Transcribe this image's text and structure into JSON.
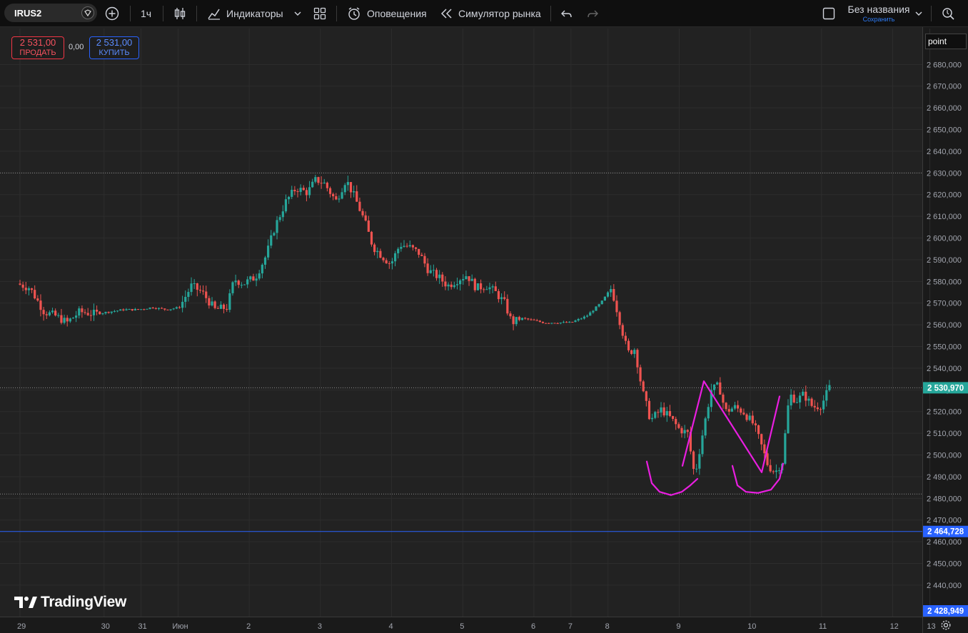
{
  "toolbar": {
    "symbol": "IRUS2",
    "interval": "1ч",
    "indicators_label": "Индикаторы",
    "alerts_label": "Оповещения",
    "replay_label": "Симулятор рынка",
    "layout_title": "Без названия",
    "save_label": "Сохранить"
  },
  "trade": {
    "sell_price": "2 531,00",
    "sell_label": "ПРОДАТЬ",
    "spread": "0,00",
    "buy_price": "2 531,00",
    "buy_label": "КУПИТЬ"
  },
  "axis_mode": "point",
  "price_labels": {
    "last": "2 530,970",
    "blue_line": "2 464,728",
    "bottom": "2 428,949"
  },
  "logo_text": "TradingView",
  "colors": {
    "up": "#26a69a",
    "down": "#ef5350",
    "drawing": "#e91ee0",
    "hline": "#2962ff"
  },
  "icons": [
    "plus-circle-icon",
    "candles-icon",
    "indicators-icon",
    "grid-icon",
    "alert-clock-icon",
    "replay-icon",
    "undo-icon",
    "redo-icon",
    "fullscreen-icon",
    "quick-search-icon",
    "settings-gear-icon"
  ],
  "chart_data": {
    "type": "candlestick",
    "interval": "1ч",
    "y_ticks": [
      "2 680,000",
      "2 670,000",
      "2 660,000",
      "2 650,000",
      "2 640,000",
      "2 630,000",
      "2 620,000",
      "2 610,000",
      "2 600,000",
      "2 590,000",
      "2 580,000",
      "2 570,000",
      "2 560,000",
      "2 550,000",
      "2 540,000",
      "2 530,000",
      "2 520,000",
      "2 510,000",
      "2 500,000",
      "2 490,000",
      "2 480,000",
      "2 470,000",
      "2 460,000",
      "2 450,000",
      "2 440,000"
    ],
    "ylim": [
      2428,
      2688
    ],
    "x_labels": [
      {
        "label": "29",
        "t": 0
      },
      {
        "label": "30",
        "t": 118
      },
      {
        "label": "31",
        "t": 170
      },
      {
        "label": "Июн",
        "t": 222
      },
      {
        "label": "2",
        "t": 322
      },
      {
        "label": "3",
        "t": 422
      },
      {
        "label": "4",
        "t": 522
      },
      {
        "label": "5",
        "t": 622
      },
      {
        "label": "6",
        "t": 722
      },
      {
        "label": "7",
        "t": 774
      },
      {
        "label": "8",
        "t": 826
      },
      {
        "label": "9",
        "t": 926
      },
      {
        "label": "10",
        "t": 1026
      },
      {
        "label": "11",
        "t": 1126
      },
      {
        "label": "12",
        "t": 1226
      },
      {
        "label": "13",
        "t": 1278
      }
    ],
    "dotted_levels": [
      2630,
      2530.97,
      2482
    ],
    "horizontal_line": 2464.728,
    "last_price": 2530.97,
    "anchors": [
      [
        0,
        2579
      ],
      [
        18,
        2577
      ],
      [
        38,
        2566
      ],
      [
        55,
        2564
      ],
      [
        70,
        2561
      ],
      [
        88,
        2566
      ],
      [
        110,
        2565
      ],
      [
        130,
        2566
      ],
      [
        150,
        2567
      ],
      [
        170,
        2567
      ],
      [
        190,
        2568
      ],
      [
        210,
        2567
      ],
      [
        228,
        2568
      ],
      [
        245,
        2578
      ],
      [
        260,
        2575
      ],
      [
        278,
        2567
      ],
      [
        295,
        2568
      ],
      [
        305,
        2581
      ],
      [
        318,
        2579
      ],
      [
        335,
        2582
      ],
      [
        350,
        2592
      ],
      [
        362,
        2605
      ],
      [
        378,
        2617
      ],
      [
        392,
        2623
      ],
      [
        408,
        2621
      ],
      [
        420,
        2627
      ],
      [
        432,
        2625
      ],
      [
        448,
        2617
      ],
      [
        462,
        2627
      ],
      [
        474,
        2619
      ],
      [
        488,
        2608
      ],
      [
        500,
        2596
      ],
      [
        515,
        2591
      ],
      [
        525,
        2588
      ],
      [
        538,
        2597
      ],
      [
        550,
        2596
      ],
      [
        565,
        2593
      ],
      [
        578,
        2585
      ],
      [
        592,
        2582
      ],
      [
        605,
        2578
      ],
      [
        620,
        2581
      ],
      [
        632,
        2583
      ],
      [
        645,
        2577
      ],
      [
        660,
        2578
      ],
      [
        672,
        2575
      ],
      [
        685,
        2570
      ],
      [
        695,
        2561
      ],
      [
        710,
        2563
      ],
      [
        725,
        2562
      ],
      [
        740,
        2561
      ],
      [
        760,
        2561
      ],
      [
        778,
        2561
      ],
      [
        800,
        2564
      ],
      [
        820,
        2570
      ],
      [
        835,
        2577
      ],
      [
        848,
        2560
      ],
      [
        858,
        2547
      ],
      [
        868,
        2549
      ],
      [
        878,
        2530
      ],
      [
        890,
        2516
      ],
      [
        905,
        2521
      ],
      [
        918,
        2517
      ],
      [
        930,
        2512
      ],
      [
        942,
        2510
      ],
      [
        952,
        2490
      ],
      [
        962,
        2508
      ],
      [
        975,
        2530
      ],
      [
        986,
        2532
      ],
      [
        995,
        2520
      ],
      [
        1008,
        2522
      ],
      [
        1020,
        2520
      ],
      [
        1035,
        2514
      ],
      [
        1045,
        2505
      ],
      [
        1055,
        2495
      ],
      [
        1065,
        2492
      ],
      [
        1075,
        2497
      ],
      [
        1085,
        2528
      ],
      [
        1095,
        2525
      ],
      [
        1105,
        2528
      ],
      [
        1118,
        2522
      ],
      [
        1130,
        2523
      ],
      [
        1141,
        2531
      ]
    ],
    "drawings": [
      {
        "type": "polyline",
        "name": "zigzag",
        "points": [
          [
            956,
            2495
          ],
          [
            986,
            2534
          ],
          [
            1067,
            2492
          ],
          [
            1092,
            2527
          ]
        ]
      },
      {
        "type": "arc",
        "name": "left-bottom-arc",
        "points": [
          [
            906,
            2497
          ],
          [
            913,
            2487
          ],
          [
            924,
            2483
          ],
          [
            940,
            2481.5
          ],
          [
            955,
            2483
          ],
          [
            967,
            2486
          ],
          [
            977,
            2489
          ]
        ]
      },
      {
        "type": "arc",
        "name": "right-bottom-arc",
        "points": [
          [
            1026,
            2495
          ],
          [
            1033,
            2486
          ],
          [
            1045,
            2483
          ],
          [
            1062,
            2482.5
          ],
          [
            1080,
            2484
          ],
          [
            1092,
            2489
          ],
          [
            1097,
            2496
          ]
        ]
      }
    ]
  }
}
